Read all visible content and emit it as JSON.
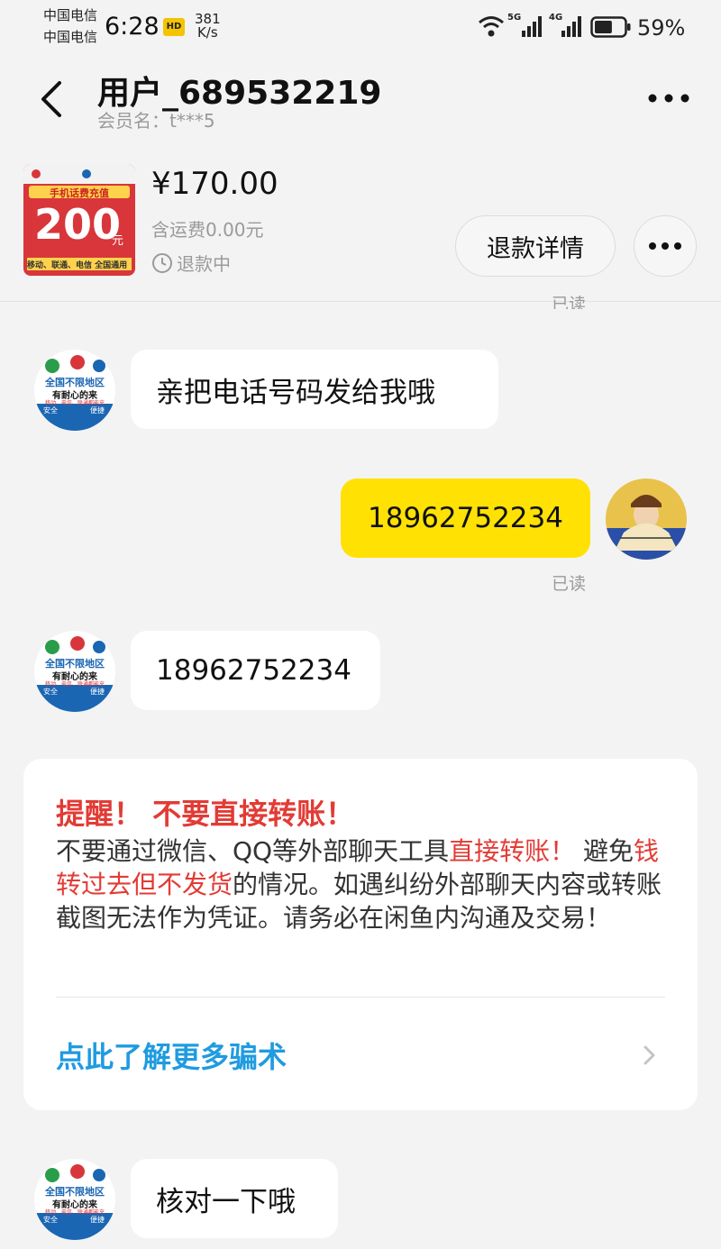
{
  "status_bar": {
    "carrier_1": "中国电信",
    "carrier_2": "中国电信",
    "time": "6:28",
    "hd_badge": "HD",
    "speed_value": "381",
    "speed_unit": "K/s",
    "network_1": "5G",
    "network_2": "4G",
    "battery": "59%",
    "battery_level": 0.59
  },
  "header": {
    "title": "用户_689532219",
    "subtitle": "会员名：t***5"
  },
  "product": {
    "thumb_label_1": "手机话费充值",
    "thumb_value": "200",
    "thumb_unit": "元",
    "thumb_footer": "移动、联通、电信 全国通用",
    "price": "¥170.00",
    "shipping": "含运费0.00元",
    "status": "退款中",
    "refund_button": "退款详情"
  },
  "colors": {
    "accent_yellow": "#ffe104",
    "warning_red": "#e23b35",
    "link_blue": "#1f9be0"
  },
  "chat": {
    "read_label_top": "已读",
    "msg1": "亲把电话号码发给我哦",
    "msg2": "18962752234",
    "msg2_read": "已读",
    "msg3": "18962752234",
    "msg4": "核对一下哦",
    "avatar_text_1": "全国不限地区",
    "avatar_text_2": "有耐心的来",
    "avatar_text_3": "移动、电信、联通都能充",
    "avatar_text_4": "安全",
    "avatar_text_5": "便捷"
  },
  "warning": {
    "title": "提醒！ 不要直接转账！",
    "body_1": "不要通过微信、QQ等外部聊天工具",
    "body_red_1": "直接转账！",
    "body_2": " 避免",
    "body_red_2": "钱转过去但不发货",
    "body_3": "的情况。如遇纠纷外部聊天内容或转账截图无法作为凭证。请务必在闲鱼内沟通及交易！",
    "learn_more": "点此了解更多骗术"
  }
}
